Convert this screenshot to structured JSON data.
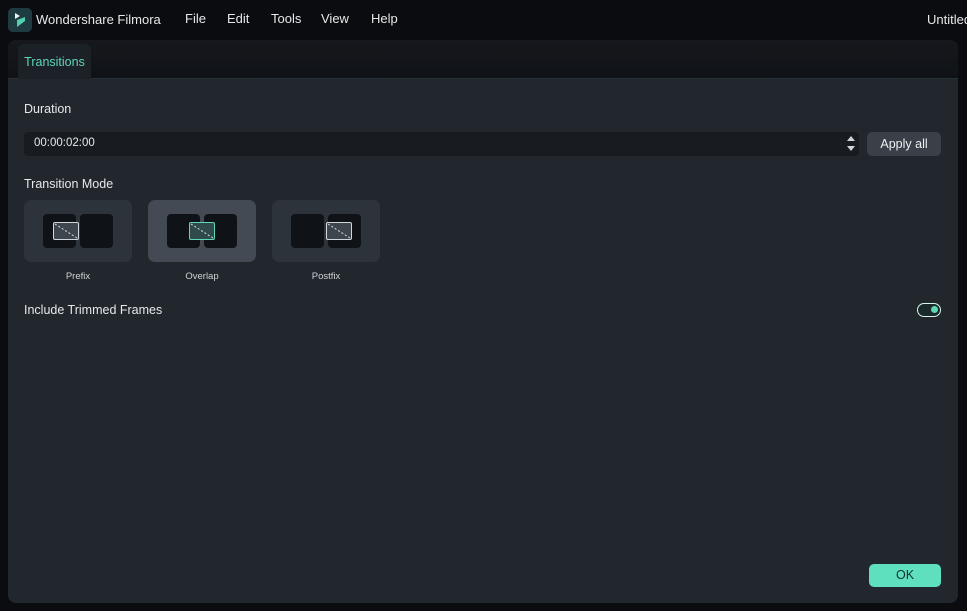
{
  "app": {
    "title": "Wondershare Filmora",
    "document_title": "Untitled",
    "logo_icon": "filmora-logo-icon"
  },
  "menu": {
    "items": [
      {
        "label": "File"
      },
      {
        "label": "Edit"
      },
      {
        "label": "Tools"
      },
      {
        "label": "View"
      },
      {
        "label": "Help"
      }
    ]
  },
  "panel": {
    "tabs": [
      {
        "label": "Transitions",
        "active": true
      }
    ],
    "duration": {
      "label": "Duration",
      "value": "00:00:02:00",
      "apply_all_label": "Apply all"
    },
    "transition_mode": {
      "label": "Transition Mode",
      "options": [
        {
          "label": "Prefix",
          "selected": false
        },
        {
          "label": "Overlap",
          "selected": true
        },
        {
          "label": "Postfix",
          "selected": false
        }
      ]
    },
    "include_trimmed_frames": {
      "label": "Include Trimmed Frames",
      "enabled": true
    },
    "ok_label": "OK"
  },
  "colors": {
    "accent": "#5ee0bf",
    "tab_text": "#5fd6b7",
    "panel_bg": "#22272e",
    "titlebar_bg": "#0b0c0f"
  }
}
